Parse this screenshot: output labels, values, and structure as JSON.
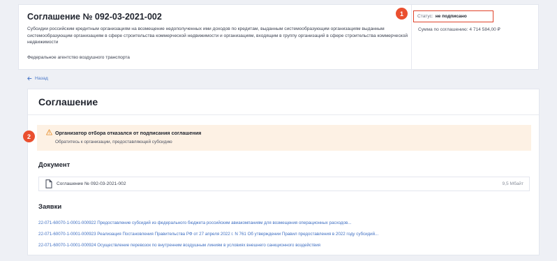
{
  "agreement": {
    "title": "Соглашение № 092-03-2021-002",
    "description": "Субсидии российским кредитным организациям на возмещение недополученных ими доходов по кредитам, выданным системообразующим организациям выданным системообразующим организациям в сфере строительства коммерческой недвижимости и организациям, входящим в группу организаций в сфере строительства коммерческой недвижимости",
    "organization": "Федеральное агентство воздушного транспорта",
    "status_label": "Статус:",
    "status_value": "не подписано",
    "sum_text": "Сумма по соглашению: 4 714 584,00 ₽"
  },
  "callouts": {
    "one": "1",
    "two": "2"
  },
  "nav": {
    "back_label": "Назад"
  },
  "main": {
    "heading": "Соглашение",
    "alert": {
      "title": "Организатор отбора отказался от подписания соглашения",
      "subtitle": "Обратитесь к организации, предоставляющей субсидию"
    },
    "document_heading": "Документ",
    "document": {
      "name": "Соглашение № 092-03-2021-002",
      "size": "9,5 Мбайт"
    },
    "applications_heading": "Заявки",
    "applications": [
      "22-071-60070-1-0001-000922 Предоставление субсидий из федерального бюджета российским авиакомпаниям для возмещения операционных расходов...",
      "22-071-60070-1-0001-000923 Реализация Постановления Правительства РФ от 27 апреля 2022 г. N 761 Об утверждении Правил предоставления в 2022 году субсидий...",
      "22-071-60070-1-0001-000924 Осуществление перевозок по внутренним воздушным линиям в условиях внешнего санкционного воздействия"
    ]
  },
  "colors": {
    "accent_red": "#ea4f2f",
    "link_blue": "#3f6fc2",
    "alert_bg": "#fdf1e4",
    "page_bg": "#eef0f5"
  }
}
